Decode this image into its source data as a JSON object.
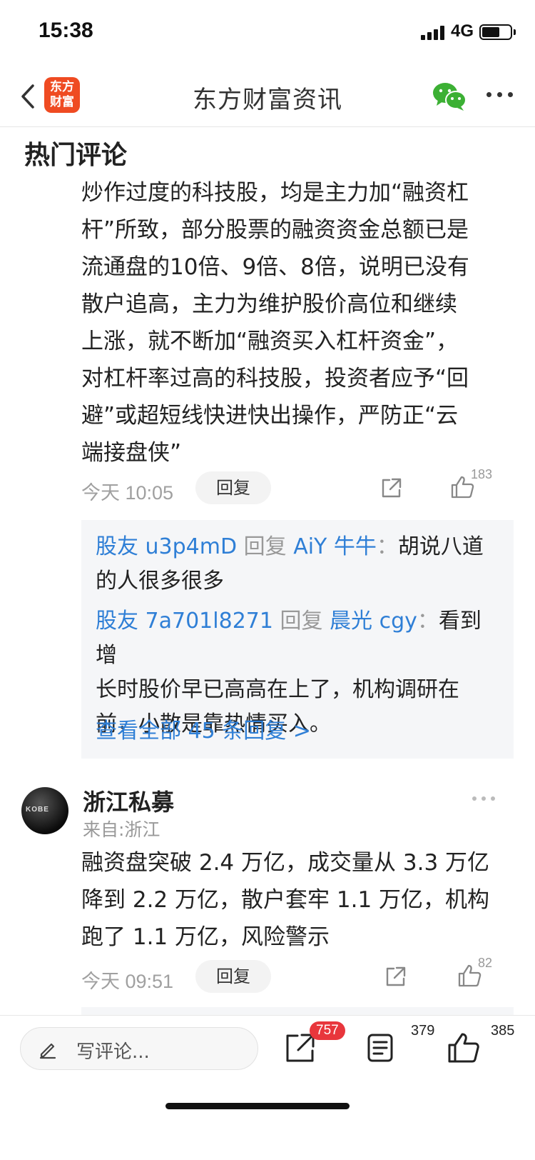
{
  "status_bar": {
    "time": "15:38",
    "network": "4G"
  },
  "nav": {
    "logo_text": "东方\n财富",
    "title": "东方财富资讯"
  },
  "section": {
    "title": "热门评论"
  },
  "comment1": {
    "lines": [
      "炒作过度的科技股，均是主力加“融资杠",
      "杆”所致，部分股票的融资资金总额已是",
      "流通盘的10倍、9倍、8倍，说明已没有",
      "散户追高，主力为维护股价高位和继续",
      "上涨，就不断加“融资买入杠杆资金”，",
      "对杠杆率过高的科技股，投资者应予“回",
      "避”或超短线快进快出操作，严防正“云",
      "端接盘侠”"
    ],
    "time": "今天 10:05",
    "reply_label": "回复",
    "like_count": "183"
  },
  "replies": {
    "items": [
      {
        "user": "股友 u3p4mD",
        "verb": "回复",
        "target": "AiY 牛牛",
        "colon": "：",
        "text_line1": "胡说八道",
        "text_line2": "的人很多很多"
      },
      {
        "user": "股友 7a701l8271",
        "verb": "回复",
        "target": "晨光 cgy",
        "colon": "：",
        "text_line1": "看到增",
        "text_line2": "长时股价早已高高在上了，机构调研在",
        "text_line3": "前，小散是靠热情买入。"
      }
    ],
    "view_all": "查看全部 45 条回复 >"
  },
  "comment2": {
    "author": "浙江私募",
    "location": "来自:浙江",
    "avatar_text": "KOBE",
    "lines": [
      "融资盘突破 2.4 万亿，成交量从 3.3 万亿",
      "降到 2.2 万亿，散户套牢 1.1 万亿，机构",
      "跑了 1.1 万亿，风险警示"
    ],
    "time": "今天 09:51",
    "reply_label": "回复",
    "like_count": "82"
  },
  "bottom_bar": {
    "write_placeholder": "写评论...",
    "share_badge": "757",
    "comments_count": "379",
    "likes_count": "385"
  },
  "colors": {
    "link": "#2f7fd6",
    "brand": "#ef4b22",
    "badge": "#e8363c",
    "wechat": "#3cb034"
  }
}
